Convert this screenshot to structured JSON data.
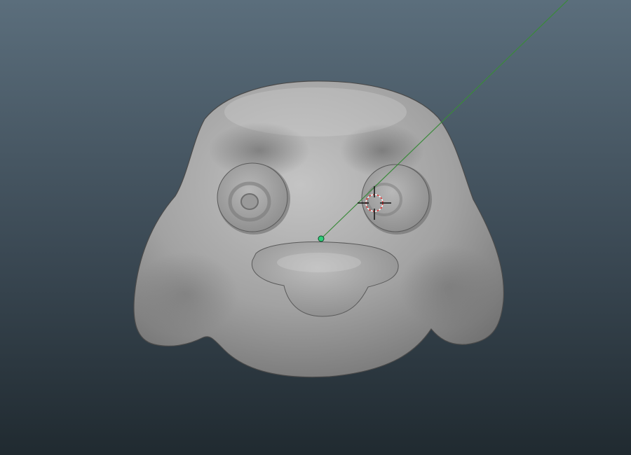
{
  "viewport": {
    "background_top": "#5b6e7c",
    "background_bottom": "#202a30"
  },
  "model": {
    "name": "sculpted-dog-head",
    "base_color": "#9e9e9e",
    "highlight_color": "#c2c2c2",
    "shadow_color": "#5f5f5f"
  },
  "manipulator": {
    "line_color": "#3a8a3a",
    "pivot_color": "#2ecf7a",
    "cursor_ring_color": "#e23030",
    "cursor_cross_color": "#111111"
  }
}
